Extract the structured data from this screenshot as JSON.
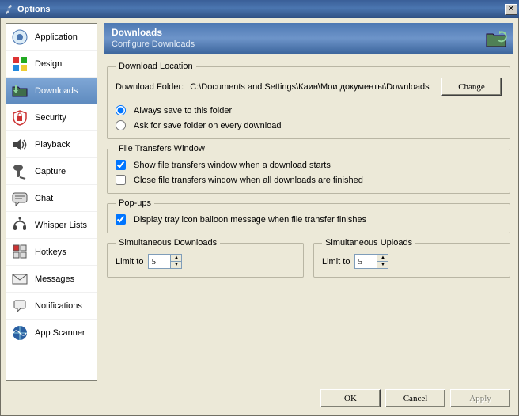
{
  "window": {
    "title": "Options"
  },
  "sidebar": {
    "items": [
      {
        "label": "Application",
        "icon": "application-icon",
        "selected": false
      },
      {
        "label": "Design",
        "icon": "design-icon",
        "selected": false
      },
      {
        "label": "Downloads",
        "icon": "downloads-icon",
        "selected": true
      },
      {
        "label": "Security",
        "icon": "security-icon",
        "selected": false
      },
      {
        "label": "Playback",
        "icon": "playback-icon",
        "selected": false
      },
      {
        "label": "Capture",
        "icon": "capture-icon",
        "selected": false
      },
      {
        "label": "Chat",
        "icon": "chat-icon",
        "selected": false
      },
      {
        "label": "Whisper Lists",
        "icon": "whisper-icon",
        "selected": false
      },
      {
        "label": "Hotkeys",
        "icon": "hotkeys-icon",
        "selected": false
      },
      {
        "label": "Messages",
        "icon": "messages-icon",
        "selected": false
      },
      {
        "label": "Notifications",
        "icon": "notifications-icon",
        "selected": false
      },
      {
        "label": "App Scanner",
        "icon": "appscanner-icon",
        "selected": false
      }
    ]
  },
  "header": {
    "title": "Downloads",
    "subtitle": "Configure Downloads"
  },
  "download_location": {
    "legend": "Download Location",
    "folder_label": "Download Folder:",
    "folder_path": "C:\\Documents and Settings\\Каин\\Мои документы\\Downloads",
    "change_btn": "Change",
    "opt_always": "Always save to this folder",
    "opt_ask": "Ask for save folder on every download",
    "selected": "always"
  },
  "file_transfers": {
    "legend": "File Transfers Window",
    "show_label": "Show file transfers window when a download starts",
    "show_checked": true,
    "close_label": "Close file transfers window when all downloads are finished",
    "close_checked": false
  },
  "popups": {
    "legend": "Pop-ups",
    "balloon_label": "Display tray icon balloon message when file transfer finishes",
    "balloon_checked": true
  },
  "sim_down": {
    "legend": "Simultaneous Downloads",
    "limit_label": "Limit to",
    "value": "5"
  },
  "sim_up": {
    "legend": "Simultaneous Uploads",
    "limit_label": "Limit to",
    "value": "5"
  },
  "buttons": {
    "ok": "OK",
    "cancel": "Cancel",
    "apply": "Apply"
  }
}
